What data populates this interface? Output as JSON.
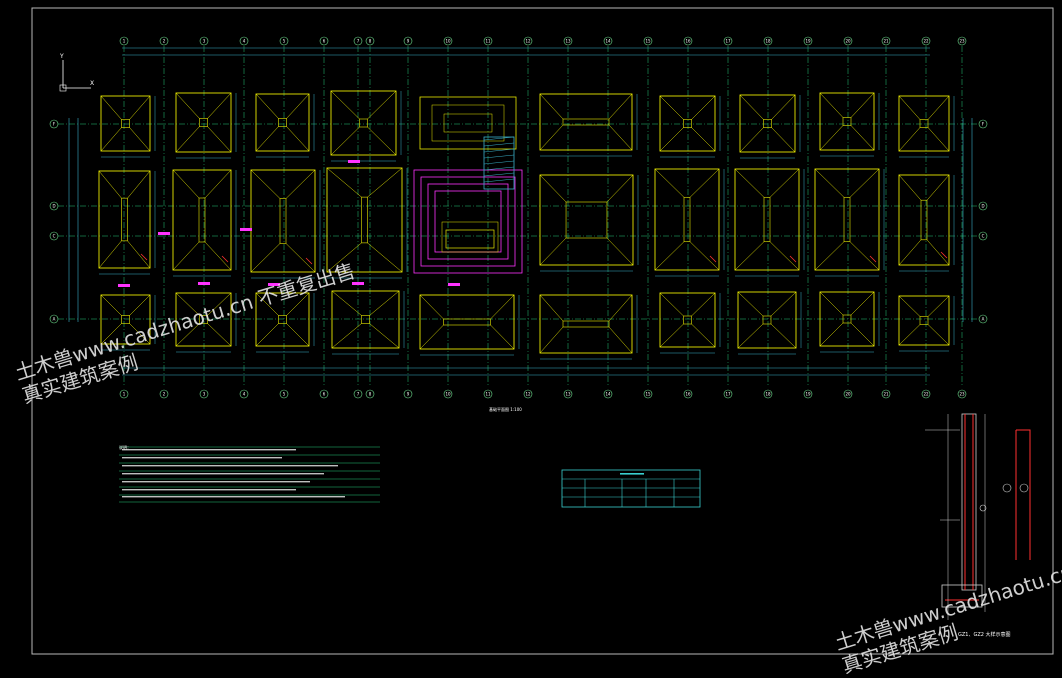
{
  "drawing": {
    "background": "#000000",
    "colors": {
      "frame": "#b8b8b8",
      "grid": "#24c77a",
      "footing": "#e8e800",
      "dimension": "#3ab0c8",
      "axis_bubble": "#6fe08f",
      "highlight": "#ff33ff",
      "text": "#ffffff",
      "red": "#ff3030",
      "table": "#3ad0d0"
    },
    "column_axes": [
      "1",
      "2",
      "3",
      "4",
      "5",
      "6",
      "7",
      "8",
      "9",
      "10",
      "11",
      "12",
      "13",
      "14",
      "15",
      "16",
      "17",
      "18",
      "19",
      "20",
      "21",
      "22",
      "23"
    ],
    "row_axes": [
      "F",
      "D",
      "C",
      "A"
    ],
    "coord_icon": {
      "y": "Y",
      "x": "X"
    },
    "plan_caption": "基础平面图 1:100",
    "section_caption": "GZ1、GZ2 大样示意图",
    "notes_heading": "说明：",
    "icons": [
      "coordinate-axis-icon",
      "footing-symbol-icon"
    ]
  },
  "watermark": {
    "line1": "土木兽www.cadzhaotu.cn 不重复出售",
    "line2": "真实建筑案例"
  }
}
